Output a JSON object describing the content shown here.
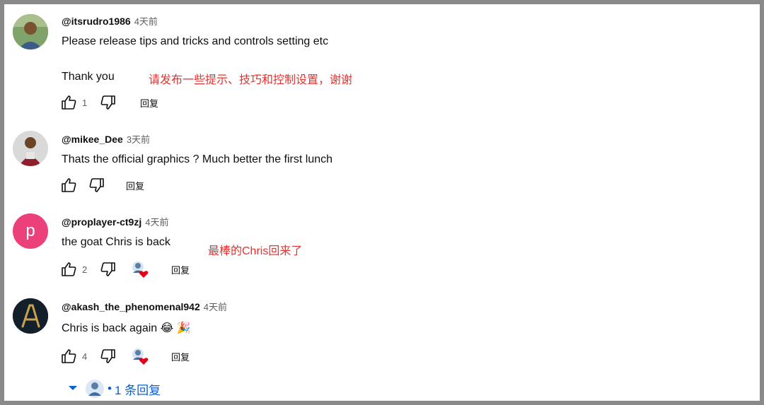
{
  "comments": [
    {
      "author": "@itsrudro1986",
      "time": "4天前",
      "text": "Please release tips and tricks and controls setting etc",
      "text2": "Thank you",
      "note": "请发布一些提示、技巧和控制设置，谢谢",
      "likes": "1",
      "reply_label": "回复"
    },
    {
      "author": "@mikee_Dee",
      "time": "3天前",
      "text": "Thats the official graphics ? Much better the first lunch",
      "reply_label": "回复"
    },
    {
      "author": "@proplayer-ct9zj",
      "time": "4天前",
      "avatar_letter": "p",
      "text": "the goat Chris is back",
      "note": "最棒的Chris回来了",
      "likes": "2",
      "reply_label": "回复"
    },
    {
      "author": "@akash_the_phenomenal942",
      "time": "4天前",
      "text": "Chris is back again 😂 🎉",
      "likes": "4",
      "reply_label": "回复"
    }
  ],
  "replies_toggle": {
    "label": "1 条回复",
    "separator": "•"
  },
  "colors": {
    "link": "#065fd4",
    "annotation": "#e8322f",
    "heart": "#e3001b",
    "p_avatar": "#ec407a"
  },
  "icons": [
    "thumbs-up-icon",
    "thumbs-down-icon",
    "creator-heart-icon",
    "chevron-down-icon"
  ]
}
